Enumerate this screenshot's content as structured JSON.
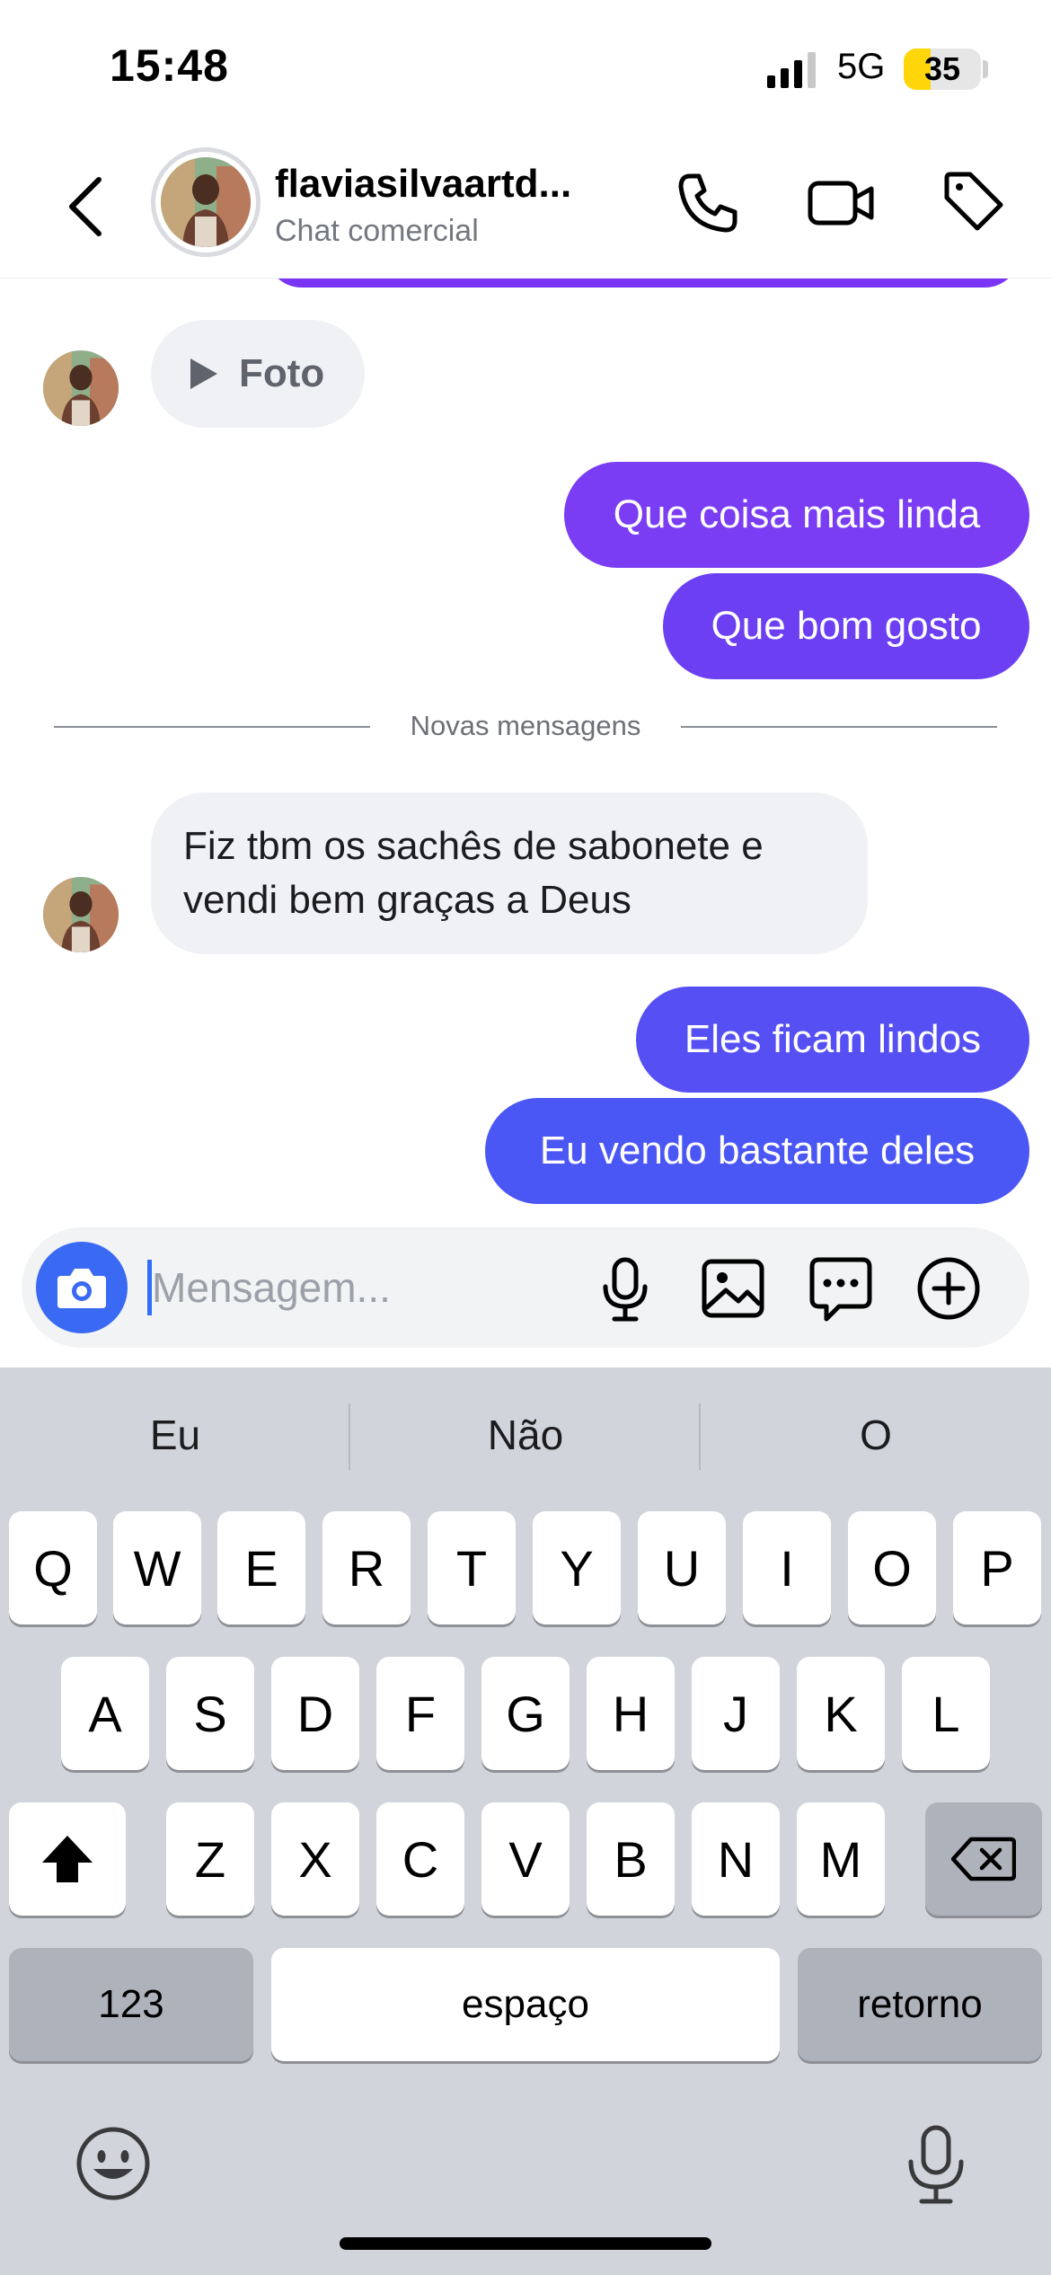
{
  "status_bar": {
    "time": "15:48",
    "network": "5G",
    "battery": "35",
    "battery_level": 0.35
  },
  "header": {
    "title": "flaviasilvaartd...",
    "subtitle": "Chat comercial",
    "icons": [
      "back-chevron-icon",
      "phone-icon",
      "video-camera-icon",
      "tag-icon"
    ]
  },
  "messages": {
    "photo_label": "Foto",
    "out_1": "Que coisa mais linda",
    "out_2": "Que bom gosto",
    "divider": "Novas mensagens",
    "in_1_line1": "Fiz tbm os sachês de sabonete e",
    "in_1_line2": "vendi bem graças a Deus",
    "out_3": "Eles ficam lindos",
    "out_4": "Eu vendo bastante deles"
  },
  "colors": {
    "purple": "#7a34f4",
    "indigo": "#5a47f3",
    "blue": "#4b57f5",
    "camera_blue": "#3a6af4"
  },
  "composer": {
    "placeholder": "Mensagem...",
    "icons": [
      "camera-icon",
      "microphone-icon",
      "gallery-icon",
      "sticker-icon",
      "plus-icon"
    ]
  },
  "keyboard": {
    "suggestions": [
      "Eu",
      "Não",
      "O"
    ],
    "row1": [
      "Q",
      "W",
      "E",
      "R",
      "T",
      "Y",
      "U",
      "I",
      "O",
      "P"
    ],
    "row2": [
      "A",
      "S",
      "D",
      "F",
      "G",
      "H",
      "J",
      "K",
      "L"
    ],
    "row3": [
      "Z",
      "X",
      "C",
      "V",
      "B",
      "N",
      "M"
    ],
    "numbers": "123",
    "space": "espaço",
    "return": "retorno",
    "icons": [
      "shift-icon",
      "backspace-icon",
      "emoji-icon",
      "dictation-icon"
    ]
  }
}
